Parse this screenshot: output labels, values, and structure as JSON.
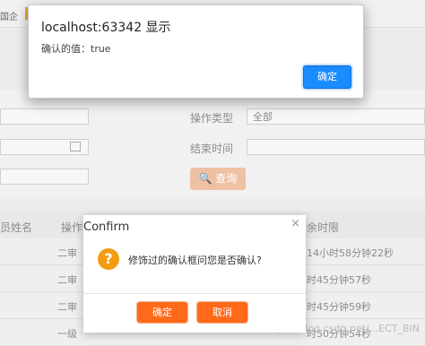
{
  "topbar": {
    "label": "国企"
  },
  "alert": {
    "title": "localhost:63342 显示",
    "message": "确认的值：true",
    "ok_label": "确定"
  },
  "filters": {
    "operation_type_label": "操作类型",
    "operation_type_value": "全部",
    "end_time_label": "结束时间",
    "search_label": "查询"
  },
  "table": {
    "headers": {
      "left": "员姓名",
      "mid": "操作",
      "right": "余时限"
    },
    "rows": [
      {
        "left": "二审",
        "right": "14小时58分钟22秒"
      },
      {
        "left": "二审",
        "right": "时45分钟57秒"
      },
      {
        "left": "二审",
        "right": "时45分钟59秒"
      },
      {
        "left": "一级",
        "right": "时50分钟54秒"
      }
    ]
  },
  "confirm": {
    "title": "Confirm",
    "close": "×",
    "icon_char": "?",
    "message": "修饰过的确认框问您是否确认?",
    "ok_label": "确定",
    "cancel_label": "取消"
  },
  "watermark": "https://blog.csdn.net/...ECT_BIN",
  "colors": {
    "alert_ok": "#1a8cfe",
    "confirm_btn": "#ff6a1a",
    "confirm_icon": "#f39c12",
    "search_btn": "#efc1a4"
  }
}
